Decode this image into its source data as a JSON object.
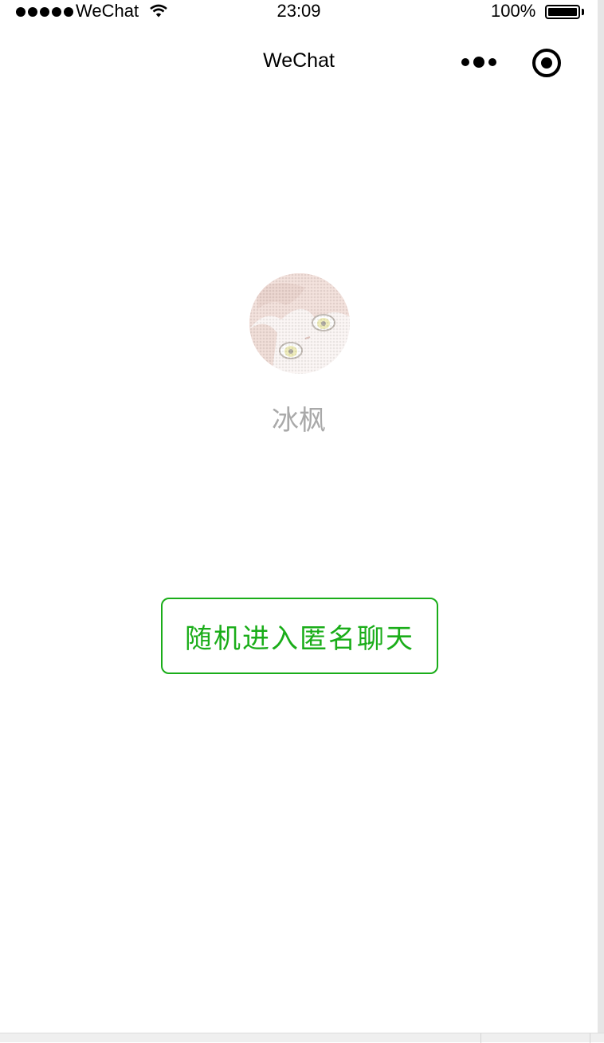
{
  "status_bar": {
    "carrier": "WeChat",
    "time": "23:09",
    "battery_percent": "100%",
    "battery_level": 1.0,
    "signal_bars": 5
  },
  "nav": {
    "title": "WeChat",
    "icons": [
      "more-icon",
      "close-icon"
    ]
  },
  "profile": {
    "nickname": "冰枫",
    "avatar_icon": "avatar-image"
  },
  "actions": {
    "random_chat_label": "随机进入匿名聊天"
  },
  "colors": {
    "accent": "#1aad19",
    "nickname_text": "#a9a9a9",
    "background": "#ffffff"
  }
}
